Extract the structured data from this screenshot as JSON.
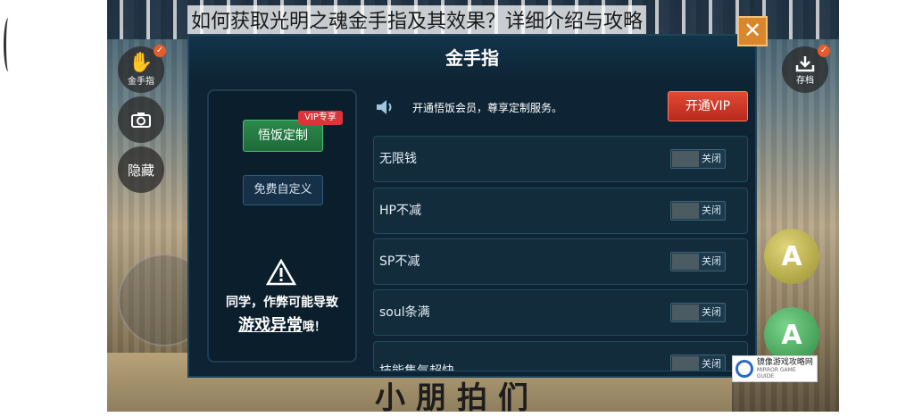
{
  "page_title": "如何获取光明之魂金手指及其效果？详细介绍与攻略",
  "dialog": {
    "title": "金手指",
    "close_label": "✕"
  },
  "side_buttons": {
    "cheat_label": "金手指",
    "cheat_badge": "✓",
    "hide_label": "隐藏",
    "save_label": "存档",
    "save_badge": "✓"
  },
  "game_buttons": {
    "a1": "A",
    "a2": "A"
  },
  "game_bottom_text": "小朋拍们",
  "left_panel": {
    "custom_label": "悟饭定制",
    "vip_tag": "VIP专享",
    "free_label": "免费自定义",
    "warning_line1": "同学，作弊可能导致",
    "warning_line2_main": "游戏异常",
    "warning_line2_suffix": "哦！"
  },
  "promo": {
    "text": "开通悟饭会员，尊享定制服务。",
    "vip_button": "开通VIP"
  },
  "options": [
    {
      "label": "无限钱",
      "state": "关闭"
    },
    {
      "label": "HP不减",
      "state": "关闭"
    },
    {
      "label": "SP不减",
      "state": "关闭"
    },
    {
      "label": "soul条满",
      "state": "关闭"
    },
    {
      "label": "技能集气超快",
      "state": "关闭"
    }
  ],
  "watermark": {
    "text": "镜像游戏攻略网",
    "sub": "MIRROR GAME GUIDE"
  },
  "colors": {
    "dialog_bg": "#0e2434",
    "accent_green": "#2c8a4c",
    "vip_red": "#d9353a",
    "close_orange": "#d9872a"
  }
}
